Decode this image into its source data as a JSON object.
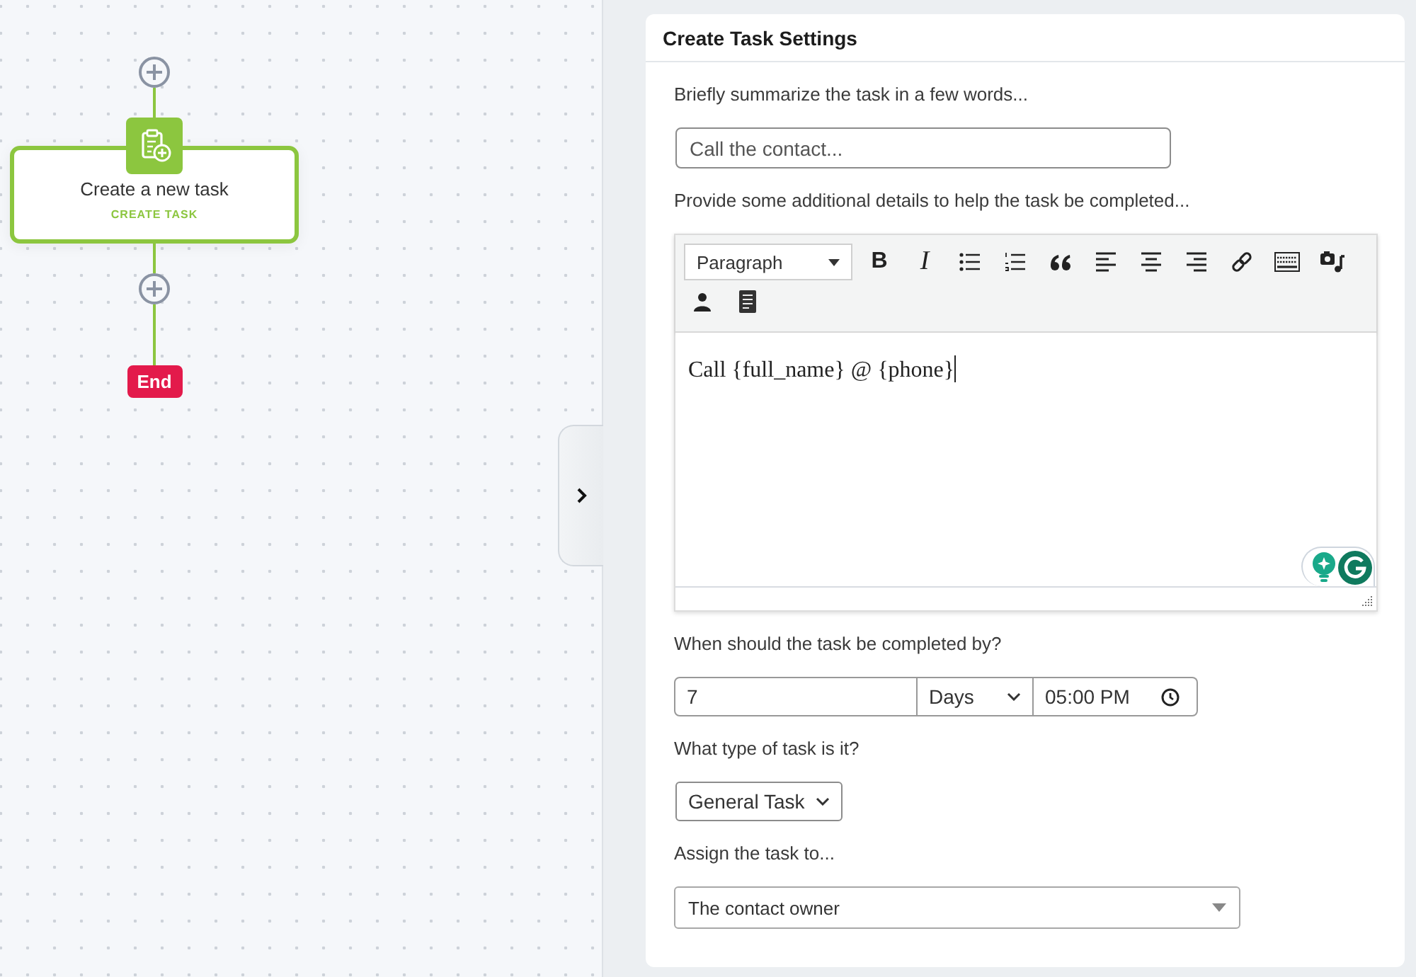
{
  "canvas": {
    "nodes": [
      {
        "kind": "add"
      },
      {
        "kind": "action",
        "title": "Create a new task",
        "subtitle": "CREATE TASK",
        "selected": true
      },
      {
        "kind": "add"
      },
      {
        "kind": "end",
        "label": "End"
      }
    ]
  },
  "settings": {
    "title": "Create Task Settings",
    "fields": [
      {
        "kind": "text",
        "label": "Briefly summarize the task in a few words...",
        "placeholder": "Call the contact..."
      },
      {
        "kind": "editor",
        "label": "Provide some additional details to help the task be completed...",
        "format": "Paragraph",
        "bold": "B",
        "italic": "I",
        "value": "Call {full_name} @ {phone}"
      },
      {
        "kind": "due",
        "label": "When should the task be completed by?",
        "amount": "7",
        "unit": "Days",
        "time": "05:00 PM"
      },
      {
        "kind": "select",
        "label": "What type of task is it?",
        "value": "General Task"
      },
      {
        "kind": "dropdown",
        "label": "Assign the task to...",
        "value": "The contact owner"
      }
    ]
  }
}
